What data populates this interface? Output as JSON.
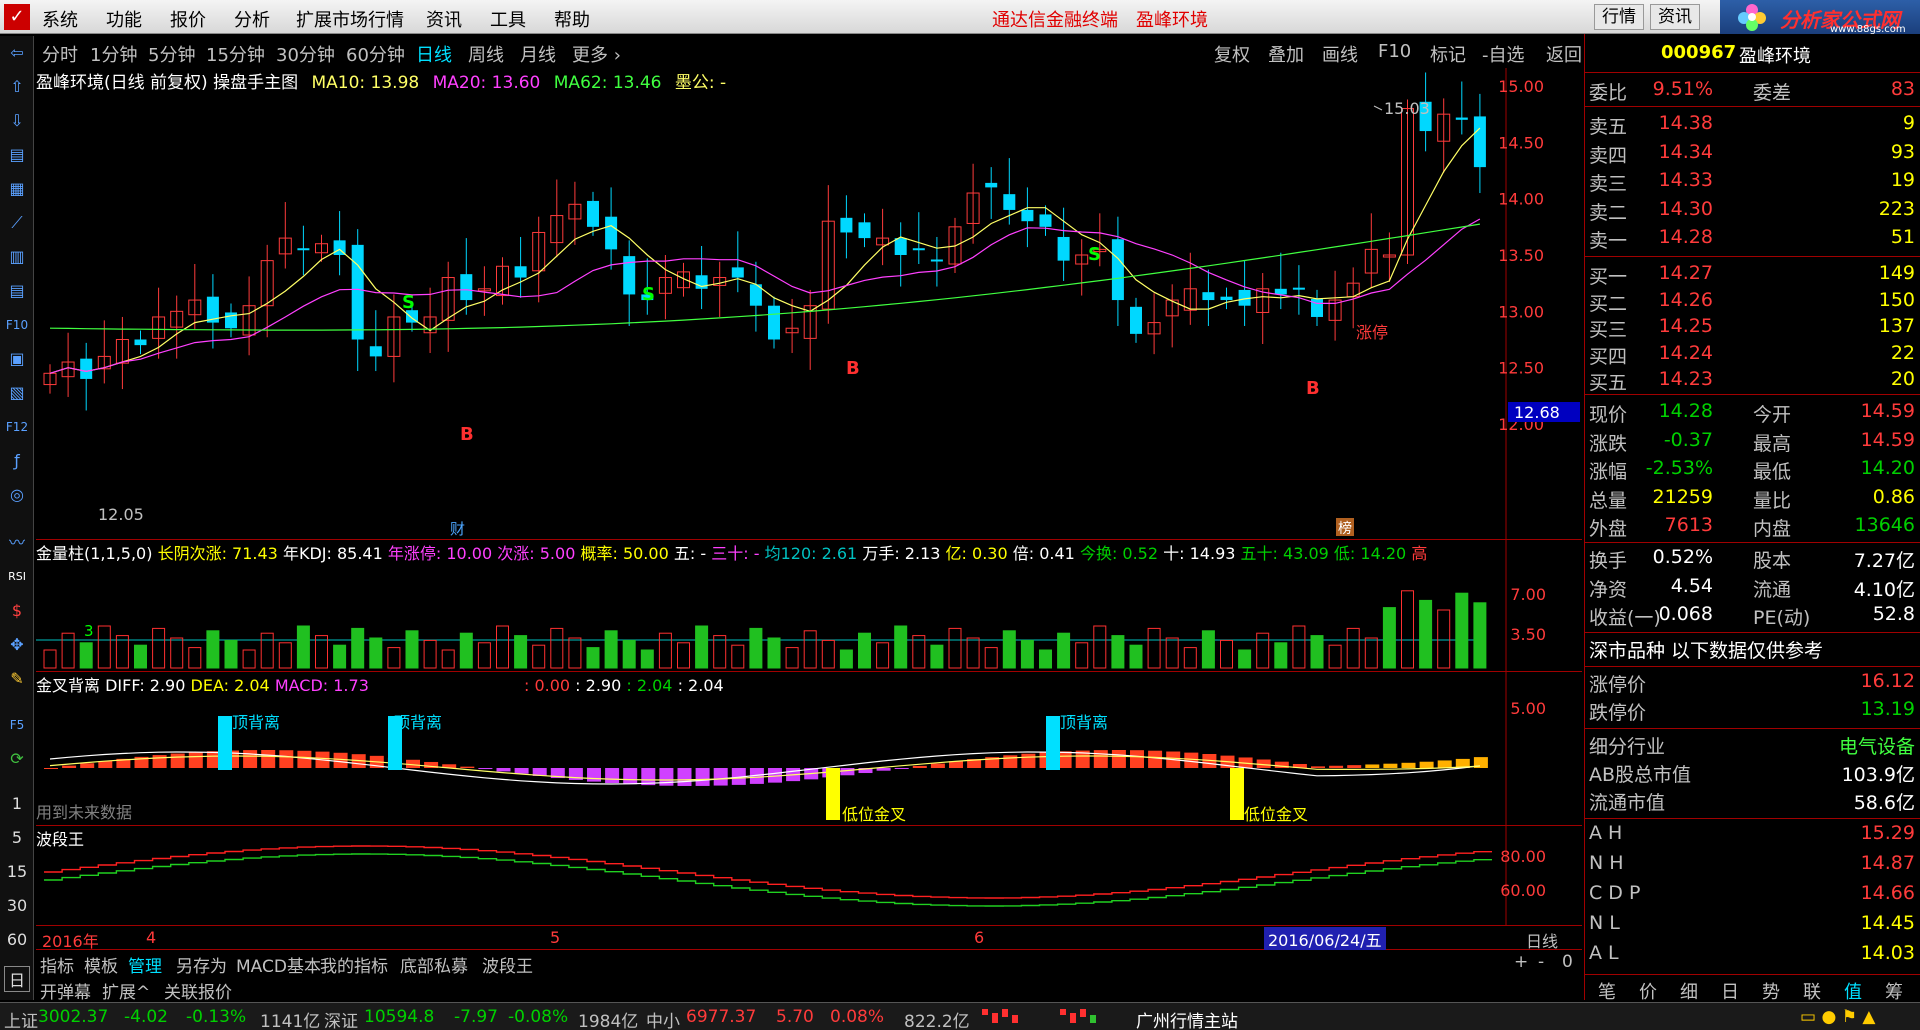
{
  "menu": {
    "items": [
      "系统",
      "功能",
      "报价",
      "分析",
      "扩展市场行情",
      "资讯",
      "工具",
      "帮助"
    ],
    "brand1": "通达信金融终端",
    "brand2": "盈峰环境",
    "right_buttons": [
      "行情",
      "资讯"
    ],
    "site_name": "分析家公式网",
    "site_url": "www.88gs.com"
  },
  "periods": [
    "分时",
    "1分钟",
    "5分钟",
    "15分钟",
    "30分钟",
    "60分钟",
    "日线",
    "周线",
    "月线",
    "更多 ›"
  ],
  "active_period": "日线",
  "chart_tools": [
    "复权",
    "叠加",
    "画线",
    "F10",
    "标记",
    "-自选",
    "返回"
  ],
  "main_header": {
    "title": "盈峰环境(日线 前复权) 操盘手主图",
    "ma10": "MA10: 13.98",
    "ma20": "MA20: 13.60",
    "ma62": "MA62: 13.46",
    "mugong": "墨公: -"
  },
  "price_axis": [
    "15.00",
    "14.50",
    "14.00",
    "13.50",
    "13.00",
    "12.50",
    "12.00"
  ],
  "price_marker": "12.68",
  "high_label": "15.03",
  "low_label": "12.05",
  "limit_up_label": "涨停",
  "marker_cai": "财",
  "marker_bang": "榜",
  "ind1_header": {
    "name": "金量柱(1,1,5,0)",
    "f1": "长阴次涨: 71.43",
    "f2": "年KDJ: 85.41",
    "f3": "年涨停: 10.00",
    "f4": "次涨: 5.00",
    "f5": "概率: 50.00",
    "f6": "五: -",
    "f7": "三十: -",
    "f8": "均120: 2.61",
    "f9": "万手: 2.13",
    "f10": "亿: 0.30",
    "f11": "倍: 0.41",
    "f12": "今换: 0.52",
    "f13": "十: 14.93",
    "f14": "五十: 43.09",
    "f15": "低: 14.20",
    "f16": "高"
  },
  "ind1_axis": [
    "7.00",
    "3.50"
  ],
  "ind1_label3": "3",
  "ind2_header": {
    "name": "金叉背离",
    "diff": "DIFF: 2.90",
    "dea": "DEA: 2.04",
    "macd": "MACD: 1.73",
    "v1": ": 0.00",
    "v2": ": 2.90",
    "v3": ": 2.04",
    "v4": ": 2.04"
  },
  "ind2_axis": [
    "5.00"
  ],
  "ind2_labels": {
    "div": "顶背离",
    "cross": "低位金叉",
    "future": "用到未来数据"
  },
  "ind3_header": {
    "name": "波段王"
  },
  "ind3_axis": [
    "80.00",
    "60.00"
  ],
  "date_axis": {
    "year": "2016年",
    "m4": "4",
    "m5": "5",
    "m6": "6",
    "cursor": "2016/06/24/五",
    "period": "日线"
  },
  "bottom_tabs": [
    "指标",
    "模板",
    "管理",
    "另存为",
    "MACD基本",
    "我的指标",
    "底部私募",
    "波段王"
  ],
  "bottom_tabs2": [
    "开弹幕",
    "扩展^",
    "关联报价"
  ],
  "zoom_controls": [
    "+",
    "-",
    "0"
  ],
  "left_numbers": [
    "1",
    "5",
    "15",
    "30",
    "60",
    "日"
  ],
  "quote": {
    "code": "000967",
    "name": "盈峰环境",
    "weibi": {
      "label": "委比",
      "value": "9.51%",
      "label2": "委差",
      "value2": "83"
    },
    "sell": [
      {
        "label": "卖五",
        "price": "14.38",
        "vol": "9"
      },
      {
        "label": "卖四",
        "price": "14.34",
        "vol": "93"
      },
      {
        "label": "卖三",
        "price": "14.33",
        "vol": "19"
      },
      {
        "label": "卖二",
        "price": "14.30",
        "vol": "223"
      },
      {
        "label": "卖一",
        "price": "14.28",
        "vol": "51"
      }
    ],
    "buy": [
      {
        "label": "买一",
        "price": "14.27",
        "vol": "149"
      },
      {
        "label": "买二",
        "price": "14.26",
        "vol": "150"
      },
      {
        "label": "买三",
        "price": "14.25",
        "vol": "137"
      },
      {
        "label": "买四",
        "price": "14.24",
        "vol": "22"
      },
      {
        "label": "买五",
        "price": "14.23",
        "vol": "20"
      }
    ],
    "stats": [
      {
        "a": "现价",
        "b": "14.28",
        "bc": "green",
        "c": "今开",
        "d": "14.59",
        "dc": "red"
      },
      {
        "a": "涨跌",
        "b": "-0.37",
        "bc": "green",
        "c": "最高",
        "d": "14.59",
        "dc": "red"
      },
      {
        "a": "涨幅",
        "b": "-2.53%",
        "bc": "green",
        "c": "最低",
        "d": "14.20",
        "dc": "green"
      },
      {
        "a": "总量",
        "b": "21259",
        "bc": "yellow",
        "c": "量比",
        "d": "0.86",
        "dc": "yellow"
      },
      {
        "a": "外盘",
        "b": "7613",
        "bc": "red",
        "c": "内盘",
        "d": "13646",
        "dc": "green"
      }
    ],
    "stats2": [
      {
        "a": "换手",
        "b": "0.52%",
        "c": "股本",
        "d": "7.27亿"
      },
      {
        "a": "净资",
        "b": "4.54",
        "c": "流通",
        "d": "4.10亿"
      },
      {
        "a": "收益(一)",
        "b": "0.068",
        "c": "PE(动)",
        "d": "52.8"
      }
    ],
    "market_note": "深市品种  以下数据仅供参考",
    "limit_up": {
      "label": "涨停价",
      "value": "16.12"
    },
    "limit_down": {
      "label": "跌停价",
      "value": "13.19"
    },
    "industry": {
      "label": "细分行业",
      "value": "电气设备"
    },
    "ab_cap": {
      "label": "AB股总市值",
      "value": "103.9亿"
    },
    "float_cap": {
      "label": "流通市值",
      "value": "58.6亿"
    },
    "levels": [
      {
        "label": "A H",
        "value": "15.29",
        "color": "red"
      },
      {
        "label": "N H",
        "value": "14.87",
        "color": "red"
      },
      {
        "label": "C D P",
        "value": "14.66",
        "color": "red"
      },
      {
        "label": "N L",
        "value": "14.45",
        "color": "yellow"
      },
      {
        "label": "A L",
        "value": "14.03",
        "color": "yellow"
      }
    ],
    "tabs": [
      "笔",
      "价",
      "细",
      "日",
      "势",
      "联",
      "值",
      "筹"
    ]
  },
  "status": {
    "sh_label": "上证",
    "sh_val": "3002.37",
    "sh_chg": "-4.02",
    "sh_pct": "-0.13%",
    "sh_amt": "1141亿",
    "sz_label": "深证",
    "sz_val": "10594.8",
    "sz_chg": "-7.97",
    "sz_pct": "-0.08%",
    "sz_amt": "1984亿",
    "zx_label": "中小",
    "zx_val": "6977.37",
    "zx_chg": "5.70",
    "zx_pct": "0.08%",
    "zx_amt": "822.2亿",
    "station": "广州行情主站"
  },
  "colors": {
    "up": "#ff3b3b",
    "down": "#00d8ff",
    "ma10": "#ffff66",
    "ma20": "#ff40ff",
    "ma62": "#40ff40",
    "border": "#a00000"
  }
}
